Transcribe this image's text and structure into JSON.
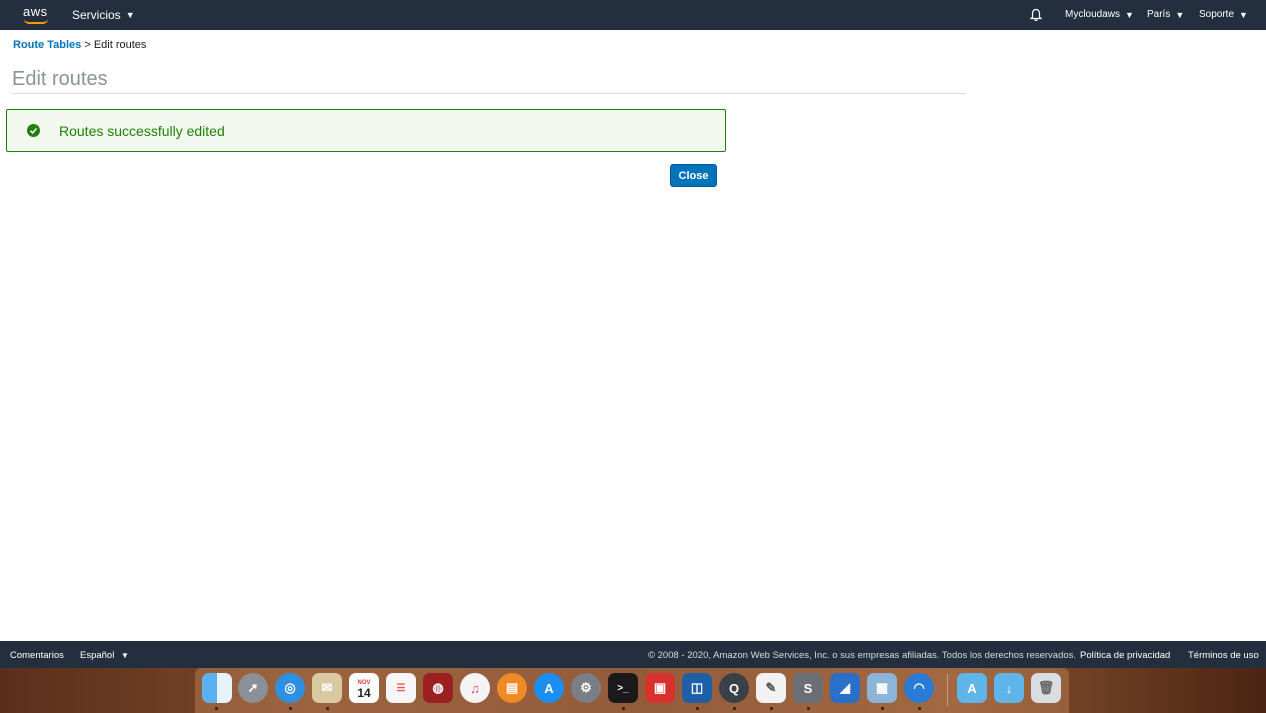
{
  "topnav": {
    "logo_text": "aws",
    "services_label": "Servicios",
    "account_label": "Mycloudaws",
    "region_label": "París",
    "support_label": "Soporte"
  },
  "breadcrumb": {
    "link_label": "Route Tables",
    "separator": ">",
    "current": "Edit routes"
  },
  "page_title": "Edit routes",
  "alert": {
    "message": "Routes successfully edited",
    "status_color": "#1d8102"
  },
  "close_button": "Close",
  "footer": {
    "feedback_label": "Comentarios",
    "language_label": "Español",
    "copyright": "© 2008 - 2020, Amazon Web Services, Inc. o sus empresas afiliadas. Todos los derechos reservados.",
    "privacy_label": "Política de privacidad",
    "terms_label": "Términos de uso"
  },
  "dock": {
    "calendar_month": "NOV",
    "calendar_day": "14",
    "apps": [
      "finder-icon",
      "launchpad-icon",
      "safari-icon",
      "mail-icon",
      "calendar-icon",
      "reminders-icon",
      "wineskin-icon",
      "itunes-icon",
      "books-icon",
      "app-store-icon",
      "system-preferences-icon",
      "terminal-icon",
      "parallels-icon",
      "remote-icon",
      "quicktime-icon",
      "textedit-icon",
      "scrivener-icon",
      "sharkfin-icon",
      "preview-icon",
      "browser-icon",
      "applications-folder-icon",
      "downloads-folder-icon",
      "trash-icon"
    ]
  },
  "colors": {
    "nav_bg": "#232f3e",
    "link": "#0073bb",
    "accent": "#ff9900",
    "success": "#1d8102"
  }
}
